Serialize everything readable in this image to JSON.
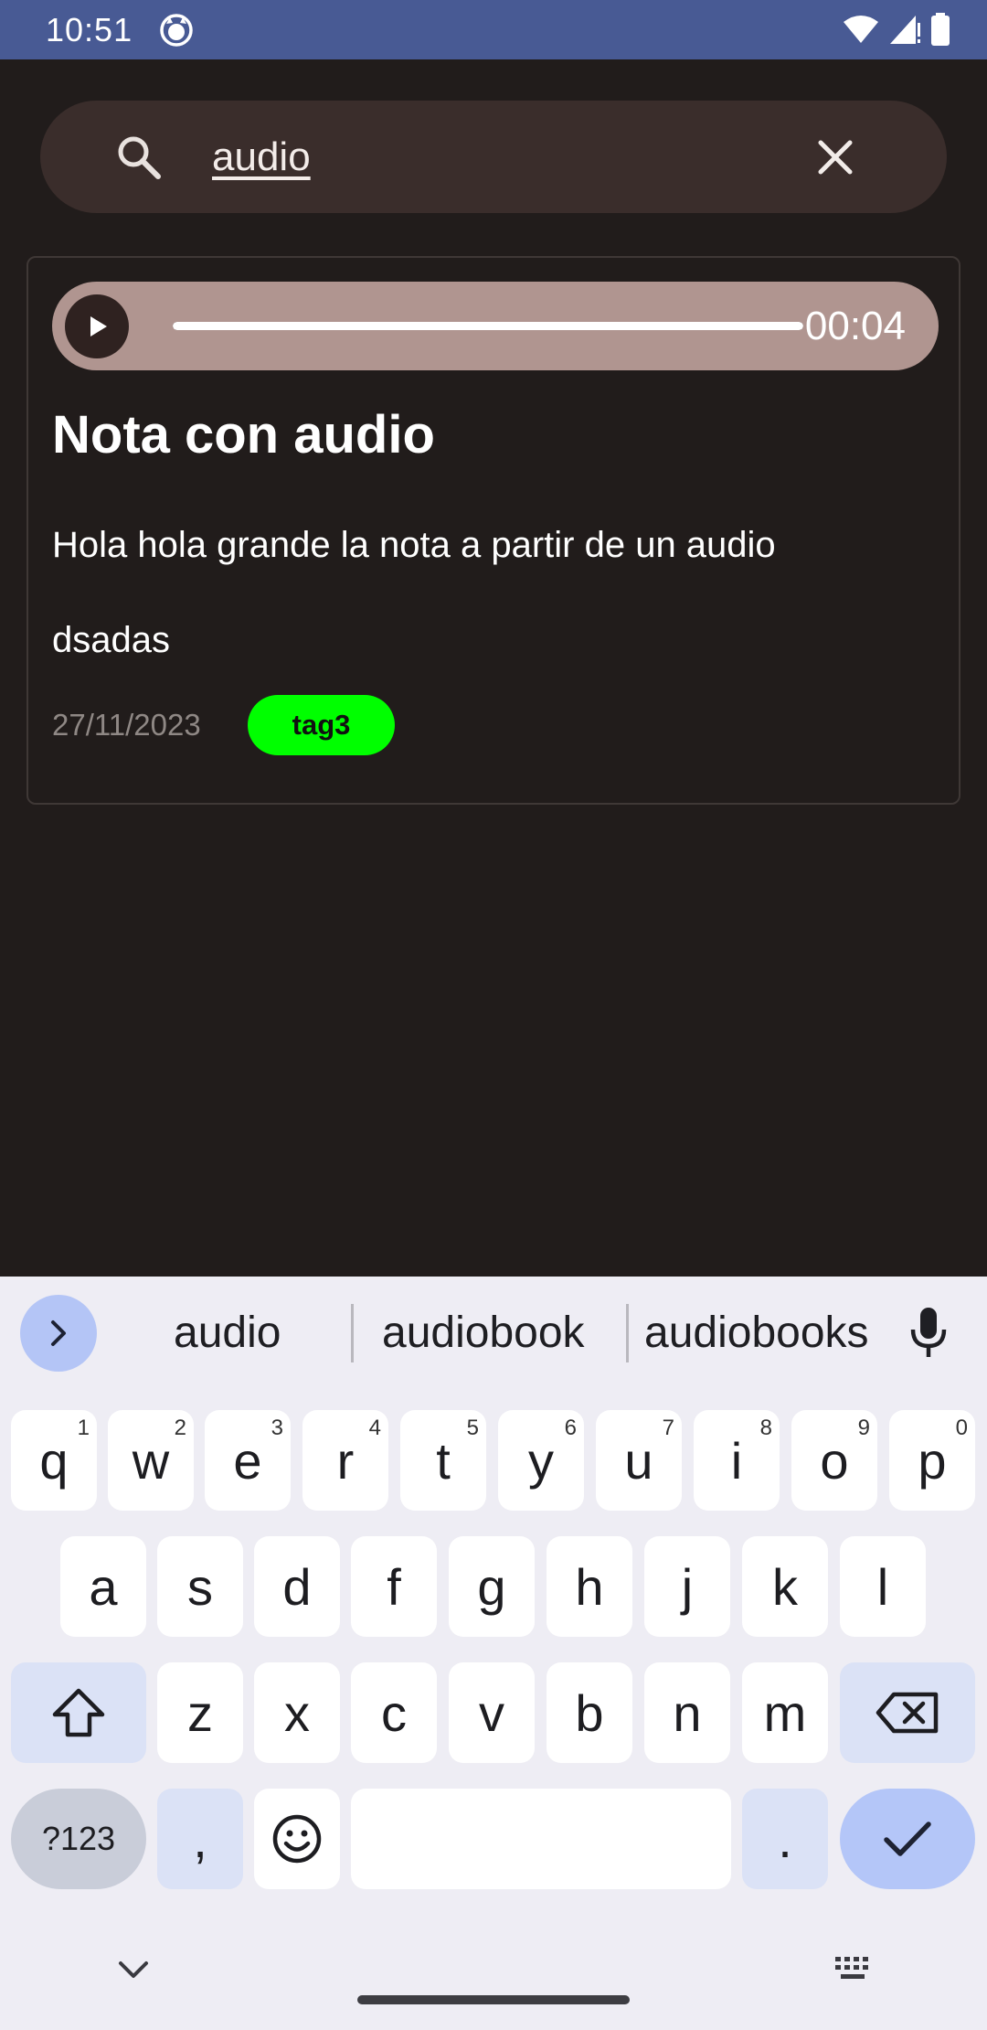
{
  "status_bar": {
    "time": "10:51",
    "icons": [
      "app-notification-icon",
      "wifi-icon",
      "signal-icon",
      "battery-icon"
    ],
    "background": "#485a94"
  },
  "search": {
    "query": "audio",
    "icon": "search-icon",
    "clear_icon": "close-icon"
  },
  "note": {
    "audio_duration": "00:04",
    "audio_progress": 1.0,
    "title": "Nota con audio",
    "body": "Hola hola grande la nota a partir de un audio\ndsadas",
    "date": "27/11/2023",
    "tag": "tag3",
    "tag_color": "#00ff00"
  },
  "keyboard": {
    "suggestions": [
      "audio",
      "audiobook",
      "audiobooks"
    ],
    "row1": [
      {
        "key": "q",
        "hint": "1"
      },
      {
        "key": "w",
        "hint": "2"
      },
      {
        "key": "e",
        "hint": "3"
      },
      {
        "key": "r",
        "hint": "4"
      },
      {
        "key": "t",
        "hint": "5"
      },
      {
        "key": "y",
        "hint": "6"
      },
      {
        "key": "u",
        "hint": "7"
      },
      {
        "key": "i",
        "hint": "8"
      },
      {
        "key": "o",
        "hint": "9"
      },
      {
        "key": "p",
        "hint": "0"
      }
    ],
    "row2": [
      "a",
      "s",
      "d",
      "f",
      "g",
      "h",
      "j",
      "k",
      "l"
    ],
    "row3": [
      "z",
      "x",
      "c",
      "v",
      "b",
      "n",
      "m"
    ],
    "symbols_label": "?123",
    "comma": ",",
    "period": "."
  }
}
